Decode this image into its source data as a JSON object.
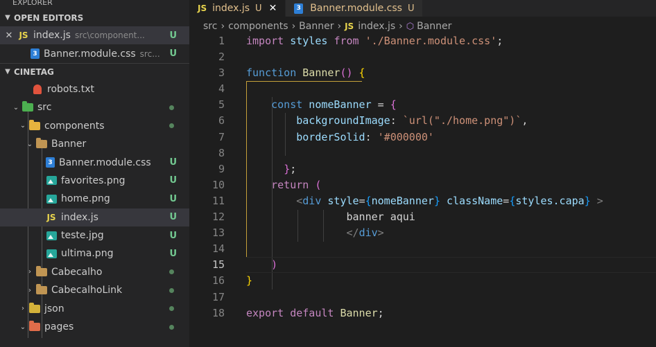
{
  "explorer": {
    "title": "EXPLORER",
    "more": "···"
  },
  "open_editors": {
    "header": "OPEN EDITORS",
    "items": [
      {
        "close": "✕",
        "icon": "JS",
        "label": "index.js",
        "path": "src\\component...",
        "status": "U"
      },
      {
        "icon": "CSS",
        "label": "Banner.module.css",
        "path": "src...",
        "status": "U"
      }
    ]
  },
  "project": {
    "header": "CINETAG",
    "items": [
      {
        "label": "robots.txt"
      },
      {
        "label": "src"
      },
      {
        "label": "components"
      },
      {
        "label": "Banner"
      },
      {
        "label": "Banner.module.css",
        "status": "U"
      },
      {
        "label": "favorites.png",
        "status": "U"
      },
      {
        "label": "home.png",
        "status": "U"
      },
      {
        "label": "index.js",
        "status": "U",
        "icon": "JS"
      },
      {
        "label": "teste.jpg",
        "status": "U"
      },
      {
        "label": "ultima.png",
        "status": "U"
      },
      {
        "label": "Cabecalho"
      },
      {
        "label": "CabecalhoLink"
      },
      {
        "label": "json"
      },
      {
        "label": "pages"
      }
    ]
  },
  "tabs": [
    {
      "icon": "JS",
      "label": "index.js",
      "status": "U",
      "close": "✕"
    },
    {
      "label": "Banner.module.css",
      "status": "U"
    }
  ],
  "breadcrumb": {
    "parts": [
      "src",
      "components",
      "Banner"
    ],
    "file_icon": "JS",
    "file": "index.js",
    "symbol": "Banner",
    "sep": "›"
  },
  "code": {
    "line_numbers": [
      "1",
      "2",
      "3",
      "4",
      "5",
      "6",
      "7",
      "8",
      "9",
      "10",
      "11",
      "12",
      "13",
      "14",
      "15",
      "16",
      "17",
      "18"
    ],
    "current_line": "15",
    "tokens": {
      "l1_import": "import",
      "l1_styles": " styles ",
      "l1_from": "from",
      "l1_path": " './Banner.module.css'",
      "l1_semi": ";",
      "l3_function": "function",
      "l3_name": " Banner",
      "l3_parens": "()",
      "l3_brace": " {",
      "l5_const": "const",
      "l5_var": " nomeBanner",
      "l5_eq": " = ",
      "l5_brace": "{",
      "l6_key": "backgroundImage",
      "l6_colon": ": ",
      "l6_val": "`url(\"./home.png\")`",
      "l6_comma": ",",
      "l7_key": "borderSolid",
      "l7_colon": ": ",
      "l7_val": "'#000000'",
      "l9_brace": "}",
      "l9_semi": ";",
      "l10_return": "return",
      "l10_paren": " (",
      "l11_open": "<",
      "l11_tag": "div",
      "l11_style": " style",
      "l11_eq1": "=",
      "l11_b1o": "{",
      "l11_v1": "nomeBanner",
      "l11_b1c": "}",
      "l11_class": " className",
      "l11_eq2": "=",
      "l11_b2o": "{",
      "l11_v2": "styles.capa",
      "l11_b2c": "}",
      "l11_close": " >",
      "l12_text": "banner aqui",
      "l13_open": "</",
      "l13_tag": "div",
      "l13_close": ">",
      "l15_paren": ")",
      "l16_brace": "}",
      "l18_export": "export",
      "l18_default": " default",
      "l18_name": " Banner",
      "l18_semi": ";"
    }
  },
  "colors": {
    "untracked": "#73c991",
    "tab_modified_label": "#e2c08d",
    "keyword": "#569cd6",
    "string": "#ce9178",
    "function": "#dcdcaa",
    "variable": "#9cdcfe"
  }
}
